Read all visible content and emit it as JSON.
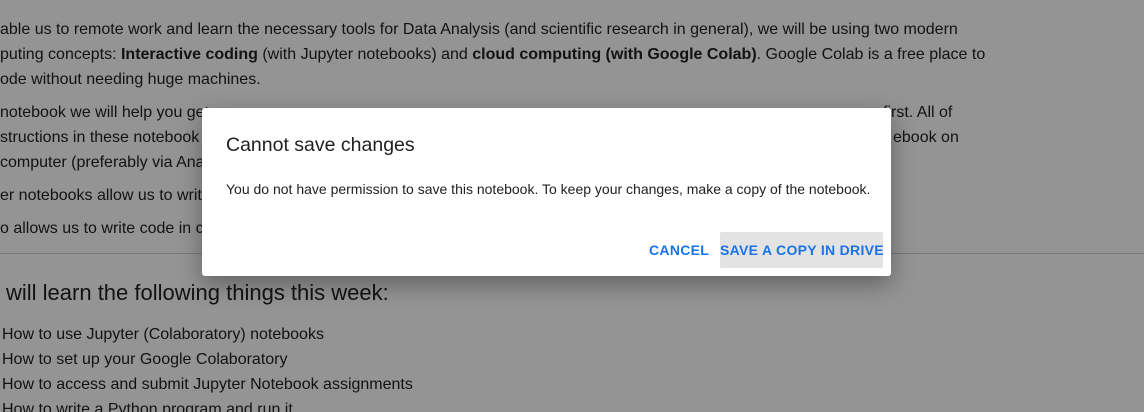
{
  "background": {
    "paragraphs": [
      {
        "line1": "able us to remote work and learn the necessary tools for Data Analysis (and scientific research in general), we will be using two modern",
        "line2_pre": "puting concepts: ",
        "line2_b1": "Interactive coding",
        "line2_mid": " (with Jupyter notebooks) and ",
        "line2_b2": "cloud computing (with Google Colab)",
        "line2_post": ". Google Colab is a free place to",
        "line3": "ode without needing huge machines."
      }
    ],
    "p2_line1_left": "notebook we will help you get",
    "p2_line1_right": "first. All of",
    "p2_line2_left": "structions in these notebook",
    "p2_line2_right": "ebook on",
    "p2_line3_left": "computer (preferably via Ana",
    "p3_left": "er notebooks allow us to writ",
    "p4_left": "o allows us to write code in co",
    "heading": "will learn the following things this week:",
    "list": [
      "How to use Jupyter (Colaboratory) notebooks",
      "How to set up your Google Colaboratory",
      "How to access and submit Jupyter Notebook assignments",
      "How to write a Python program and run it"
    ]
  },
  "dialog": {
    "title": "Cannot save changes",
    "message": "You do not have permission to save this notebook. To keep your changes, make a copy of the notebook.",
    "cancel_label": "CANCEL",
    "save_copy_label": "SAVE A COPY IN DRIVE"
  },
  "colors": {
    "accent": "#1a73e8",
    "scrim": "rgba(0,0,0,0.42)"
  }
}
